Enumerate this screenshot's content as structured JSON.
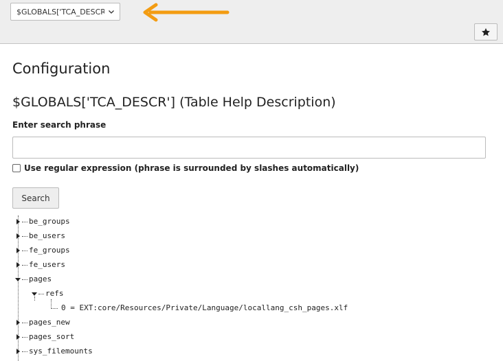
{
  "docheader": {
    "select_value": "$GLOBALS['TCA_DESCR']",
    "bookmark_title": "star"
  },
  "colors": {
    "arrow": "#f39c12",
    "header_bg": "#eeeeee"
  },
  "content": {
    "page_title": "Configuration",
    "section_title": "$GLOBALS['TCA_DESCR'] (Table Help Description)",
    "search_label": "Enter search phrase",
    "search_value": "",
    "regex_label": "Use regular expression (phrase is surrounded by slashes automatically)",
    "regex_checked": false,
    "search_button": "Search"
  },
  "tree": {
    "items": [
      {
        "label": "be_groups",
        "expanded": false
      },
      {
        "label": "be_users",
        "expanded": false
      },
      {
        "label": "fe_groups",
        "expanded": false
      },
      {
        "label": "fe_users",
        "expanded": false
      },
      {
        "label": "pages",
        "expanded": true
      },
      {
        "label": "refs",
        "expanded": true
      },
      {
        "label": "0 = EXT:core/Resources/Private/Language/locallang_csh_pages.xlf"
      },
      {
        "label": "pages_new",
        "expanded": false
      },
      {
        "label": "pages_sort",
        "expanded": false
      },
      {
        "label": "sys_filemounts",
        "expanded": false
      }
    ]
  }
}
